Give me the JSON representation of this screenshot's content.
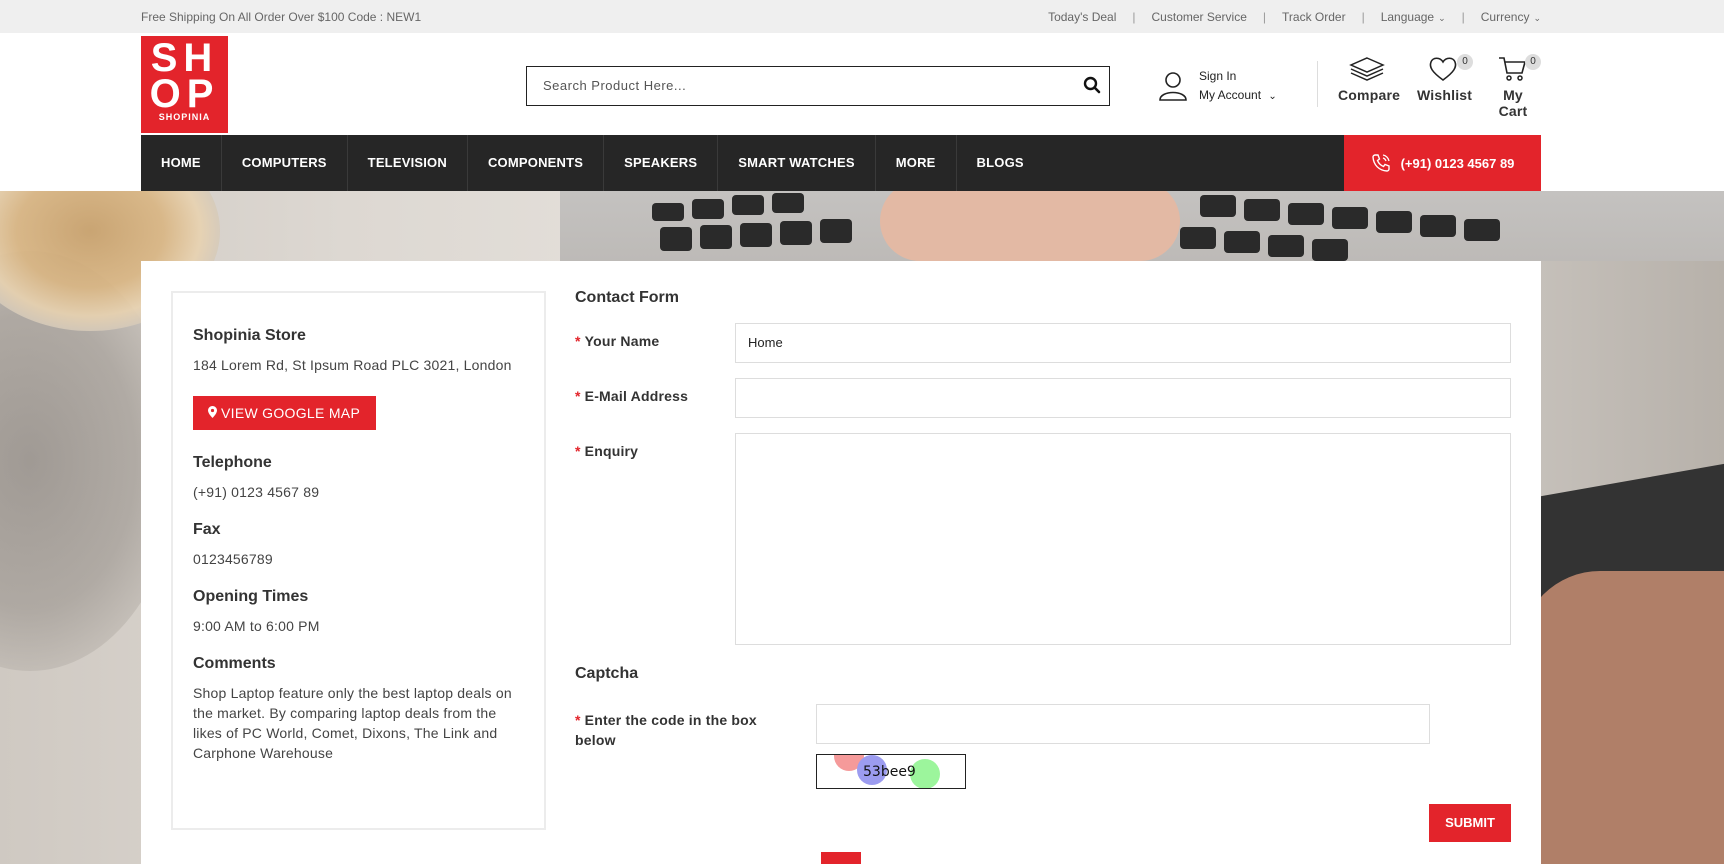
{
  "topbar": {
    "promo": "Free Shipping On All Order Over $100 Code : NEW1",
    "links": [
      "Today's Deal",
      "Customer Service",
      "Track Order"
    ],
    "language_label": "Language",
    "currency_label": "Currency"
  },
  "header": {
    "logo": {
      "line1": "SH",
      "line2": "OP",
      "brand": "SHOPINIA"
    },
    "search_placeholder": "Search Product Here...",
    "account": {
      "sign_in": "Sign In",
      "my_account": "My Account"
    },
    "compare_label": "Compare",
    "wishlist_label": "Wishlist",
    "wishlist_count": "0",
    "cart_label": "My Cart",
    "cart_count": "0"
  },
  "nav": {
    "items": [
      "HOME",
      "COMPUTERS",
      "TELEVISION",
      "COMPONENTS",
      "SPEAKERS",
      "SMART WATCHES",
      "MORE",
      "BLOGS"
    ],
    "phone": "(+91) 0123 4567 89"
  },
  "store": {
    "name": "Shopinia Store",
    "address": "184 Lorem Rd, St Ipsum Road PLC 3021, London",
    "map_button": "VIEW GOOGLE MAP",
    "telephone_heading": "Telephone",
    "telephone": "(+91) 0123 4567 89",
    "fax_heading": "Fax",
    "fax": "0123456789",
    "hours_heading": "Opening Times",
    "hours": "9:00 AM to 6:00 PM",
    "comments_heading": "Comments",
    "comments": "Shop Laptop feature only the best laptop deals on the market. By comparing laptop deals from the likes of PC World, Comet, Dixons, The Link and Carphone Warehouse"
  },
  "form": {
    "title": "Contact Form",
    "required_mark": "*",
    "name_label": "Your Name",
    "name_value": "Home",
    "email_label": "E-Mail Address",
    "email_value": "",
    "enquiry_label": "Enquiry",
    "enquiry_value": "",
    "captcha_heading": "Captcha",
    "captcha_label": "Enter the code in the box below",
    "captcha_value": "",
    "captcha_code": "53bee9",
    "submit_label": "SUBMIT"
  },
  "colors": {
    "accent": "#e3242b",
    "nav_bg": "#262626",
    "topbar_bg": "#efefef"
  },
  "icons": [
    "search-icon",
    "user-icon",
    "chevron-down-icon",
    "compare-icon",
    "heart-icon",
    "cart-icon",
    "phone-icon",
    "map-pin-icon"
  ]
}
